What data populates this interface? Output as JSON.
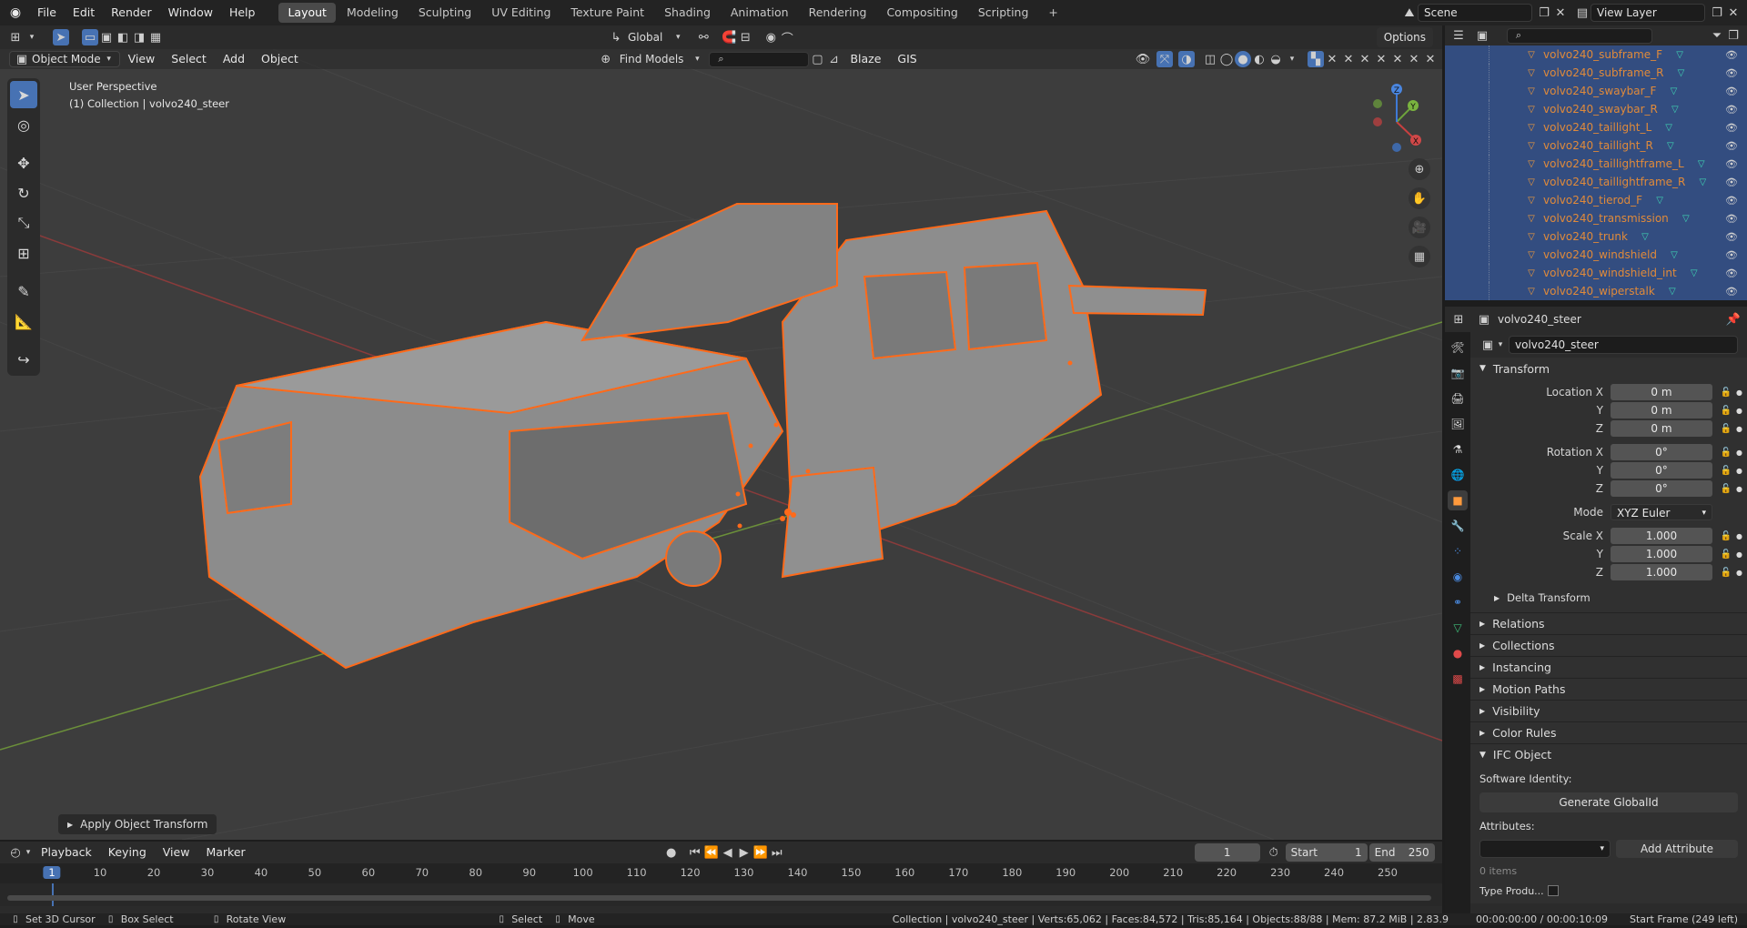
{
  "topbar": {
    "menus": [
      "File",
      "Edit",
      "Render",
      "Window",
      "Help"
    ],
    "workspaces": [
      "Layout",
      "Modeling",
      "Sculpting",
      "UV Editing",
      "Texture Paint",
      "Shading",
      "Animation",
      "Rendering",
      "Compositing",
      "Scripting"
    ],
    "add_tab": "+",
    "scene": "Scene",
    "view_layer": "View Layer"
  },
  "tool_header": {
    "orientation": "Global",
    "options": "Options"
  },
  "viewport_header": {
    "mode": "Object Mode",
    "menus": [
      "View",
      "Select",
      "Add",
      "Object"
    ],
    "find_models": "Find Models",
    "blaze": "Blaze",
    "gis": "GIS"
  },
  "viewport": {
    "perspective": "User Perspective",
    "collection_info": "(1) Collection | volvo240_steer",
    "operator_panel": "Apply Object Transform",
    "gizmo_axes": [
      "X",
      "Y",
      "Z"
    ]
  },
  "outliner": {
    "items": [
      "volvo240_subframe_F",
      "volvo240_subframe_R",
      "volvo240_swaybar_F",
      "volvo240_swaybar_R",
      "volvo240_taillight_L",
      "volvo240_taillight_R",
      "volvo240_taillightframe_L",
      "volvo240_taillightframe_R",
      "volvo240_tierod_F",
      "volvo240_transmission",
      "volvo240_trunk",
      "volvo240_windshield",
      "volvo240_windshield_int",
      "volvo240_wiperstalk"
    ]
  },
  "properties": {
    "header_object": "volvo240_steer",
    "object_name": "volvo240_steer",
    "transform_label": "Transform",
    "location": {
      "label_x": "Location X",
      "x": "0 m",
      "y": "0 m",
      "z": "0 m"
    },
    "rotation": {
      "label_x": "Rotation X",
      "x": "0°",
      "y": "0°",
      "z": "0°"
    },
    "mode_label": "Mode",
    "mode_value": "XYZ Euler",
    "scale": {
      "label_x": "Scale X",
      "x": "1.000",
      "y": "1.000",
      "z": "1.000"
    },
    "axis_y": "Y",
    "axis_z": "Z",
    "delta_transform": "Delta Transform",
    "collapsed_panels": [
      "Relations",
      "Collections",
      "Instancing",
      "Motion Paths",
      "Visibility",
      "Color Rules"
    ],
    "ifc_object": "IFC Object",
    "software_identity": "Software Identity:",
    "generate_global_id": "Generate GlobalId",
    "attributes": "Attributes:",
    "add_attribute": "Add Attribute",
    "items_count": "0 items",
    "type_product": "Type Produ..."
  },
  "timeline": {
    "menus": [
      "Playback",
      "Keying",
      "View",
      "Marker"
    ],
    "current_frame": "1",
    "start_label": "Start",
    "start": "1",
    "end_label": "End",
    "end": "250",
    "ruler": [
      "1",
      "10",
      "20",
      "30",
      "40",
      "50",
      "60",
      "70",
      "80",
      "90",
      "100",
      "110",
      "120",
      "130",
      "140",
      "150",
      "160",
      "170",
      "180",
      "190",
      "200",
      "210",
      "220",
      "230",
      "240",
      "250"
    ]
  },
  "statusbar": {
    "set_cursor": "Set 3D Cursor",
    "box_select": "Box Select",
    "rotate_view": "Rotate View",
    "select": "Select",
    "move": "Move",
    "stats": "Collection | volvo240_steer | Verts:65,062 | Faces:84,572 | Tris:85,164 | Objects:88/88 | Mem: 87.2 MiB | 2.83.9",
    "time": "00:00:00:00 / 00:00:10:09",
    "start_frame": "Start Frame (249 left)"
  },
  "colors": {
    "accent": "#4772b3",
    "selection_outline": "#ff6a1a",
    "outliner_highlight": "#334d80",
    "viewport_bg": "#3d3d3d"
  }
}
